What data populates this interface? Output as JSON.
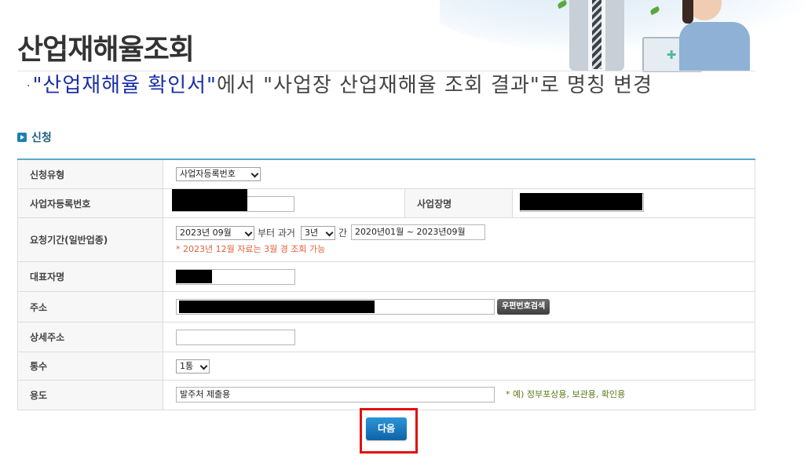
{
  "page": {
    "title": "산업재해율조회",
    "notice_bullet": "·",
    "notice_quote_open": "\"산업재해율 확인서\"",
    "notice_rest": "에서 \"사업장 산업재해율 조회 결과\"로 명칭 변경"
  },
  "section": {
    "title": "신청"
  },
  "form": {
    "type": {
      "label": "신청유형",
      "value": "사업자등록번호"
    },
    "bizno": {
      "label": "사업자등록번호"
    },
    "bizname": {
      "label": "사업장명"
    },
    "period": {
      "label": "요청기간(일반업종)",
      "month": "2023년 09월",
      "from_text": "부터 과거",
      "years": "3년",
      "gan": "간",
      "range": "2020년01월 ~ 2023년09월",
      "note": "* 2023년 12월 자료는 3월 경 조회 가능"
    },
    "rep": {
      "label": "대표자명"
    },
    "address": {
      "label": "주소",
      "search_button": "우편번호검색"
    },
    "detail": {
      "label": "상세주소"
    },
    "copies": {
      "label": "통수",
      "value": "1통"
    },
    "purpose": {
      "label": "용도",
      "value": "발주처 제출용",
      "hint": "* 예) 정부포상용, 보관용, 확인용"
    }
  },
  "actions": {
    "next_label": "다음"
  },
  "colors": {
    "accent": "#1f7fb5",
    "highlight_border": "#e01010",
    "table_top": "#5aaac8"
  }
}
